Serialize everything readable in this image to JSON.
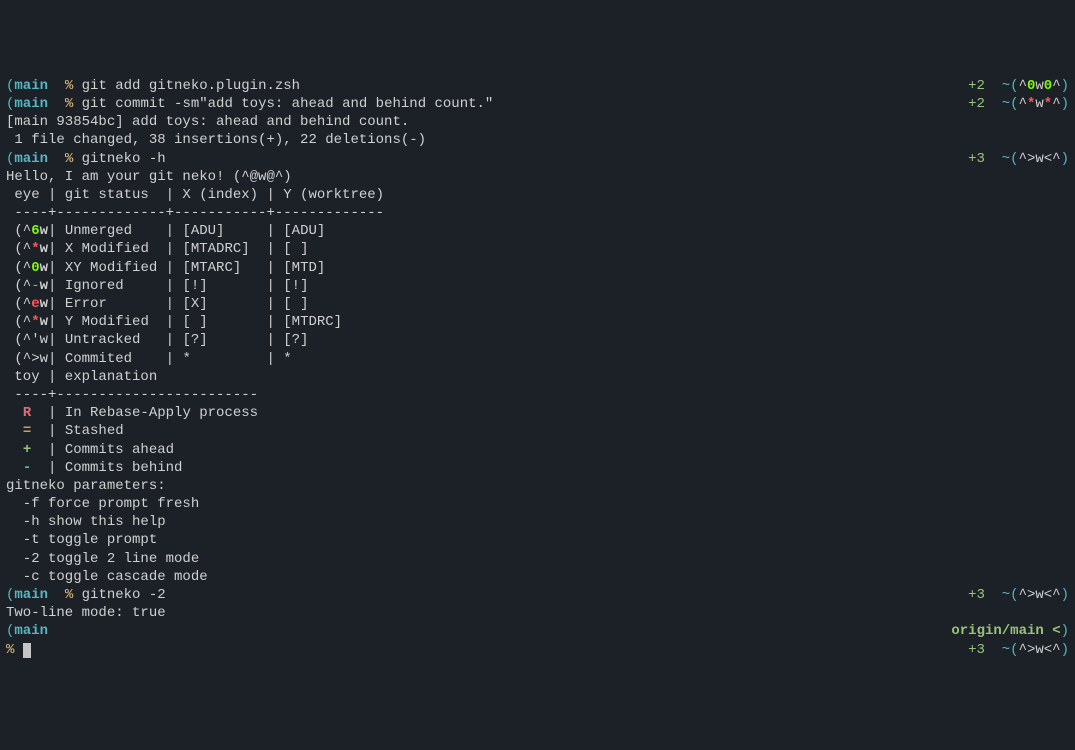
{
  "lines": [
    {
      "left": [
        {
          "text": "(",
          "class": "cyan"
        },
        {
          "text": "main",
          "class": "cyan bold"
        },
        {
          "text": "  ",
          "class": ""
        },
        {
          "text": "%",
          "class": "yellow"
        },
        {
          "text": " git add gitneko.plugin.zsh",
          "class": "white"
        }
      ],
      "right": [
        {
          "text": "+2",
          "class": "green"
        },
        {
          "text": "  ",
          "class": ""
        },
        {
          "text": "~(",
          "class": "cyan"
        },
        {
          "text": "^",
          "class": "white"
        },
        {
          "text": "0",
          "class": "bright-green"
        },
        {
          "text": "w",
          "class": "white"
        },
        {
          "text": "0",
          "class": "bright-green"
        },
        {
          "text": "^",
          "class": "white"
        },
        {
          "text": ")",
          "class": "cyan"
        }
      ]
    },
    {
      "left": [
        {
          "text": "(",
          "class": "cyan"
        },
        {
          "text": "main",
          "class": "cyan bold"
        },
        {
          "text": "  ",
          "class": ""
        },
        {
          "text": "%",
          "class": "yellow"
        },
        {
          "text": " git commit -sm\"add toys: ahead and behind count.\"",
          "class": "white"
        }
      ],
      "right": [
        {
          "text": "+2",
          "class": "green"
        },
        {
          "text": "  ",
          "class": ""
        },
        {
          "text": "~(",
          "class": "cyan"
        },
        {
          "text": "^",
          "class": "white"
        },
        {
          "text": "*",
          "class": "bright-red"
        },
        {
          "text": "w",
          "class": "white"
        },
        {
          "text": "*",
          "class": "bright-red"
        },
        {
          "text": "^",
          "class": "white"
        },
        {
          "text": ")",
          "class": "cyan"
        }
      ]
    },
    {
      "left": [
        {
          "text": "[main 93854bc] add toys: ahead and behind count.",
          "class": "white"
        }
      ],
      "right": []
    },
    {
      "left": [
        {
          "text": " 1 file changed, 38 insertions(+), 22 deletions(-)",
          "class": "white"
        }
      ],
      "right": []
    },
    {
      "left": [
        {
          "text": "(",
          "class": "cyan"
        },
        {
          "text": "main",
          "class": "cyan bold"
        },
        {
          "text": "  ",
          "class": ""
        },
        {
          "text": "%",
          "class": "yellow"
        },
        {
          "text": " gitneko -h",
          "class": "white"
        }
      ],
      "right": [
        {
          "text": "+3",
          "class": "green"
        },
        {
          "text": "  ",
          "class": ""
        },
        {
          "text": "~(",
          "class": "cyan"
        },
        {
          "text": "^>w<^",
          "class": "white"
        },
        {
          "text": ")",
          "class": "cyan"
        }
      ]
    },
    {
      "left": [
        {
          "text": "Hello, I am your git neko! (^@w@^)",
          "class": "white"
        }
      ],
      "right": []
    },
    {
      "left": [
        {
          "text": "",
          "class": ""
        }
      ],
      "right": []
    },
    {
      "left": [
        {
          "text": " eye | git status  | X (index) | Y (worktree)",
          "class": "white"
        }
      ],
      "right": []
    },
    {
      "left": [
        {
          "text": " ----+-------------+-----------+-------------",
          "class": "white"
        }
      ],
      "right": []
    },
    {
      "left": [
        {
          "text": " (^",
          "class": "white"
        },
        {
          "text": "6",
          "class": "bright-green"
        },
        {
          "text": "w",
          "class": "white bold"
        },
        {
          "text": "| Unmerged    | [ADU]     | [ADU]",
          "class": "white"
        }
      ],
      "right": []
    },
    {
      "left": [
        {
          "text": " (^",
          "class": "white"
        },
        {
          "text": "*",
          "class": "bright-red"
        },
        {
          "text": "w",
          "class": "white bold"
        },
        {
          "text": "| X Modified  | [MTADRC]  | [ ]",
          "class": "white"
        }
      ],
      "right": []
    },
    {
      "left": [
        {
          "text": " (^",
          "class": "white"
        },
        {
          "text": "0",
          "class": "bright-green"
        },
        {
          "text": "w",
          "class": "white bold"
        },
        {
          "text": "| XY Modified | [MTARC]   | [MTD]",
          "class": "white"
        }
      ],
      "right": []
    },
    {
      "left": [
        {
          "text": " (^",
          "class": "white"
        },
        {
          "text": "-",
          "class": "cyan"
        },
        {
          "text": "w",
          "class": "white bold"
        },
        {
          "text": "| Ignored     | [!]       | [!]",
          "class": "white"
        }
      ],
      "right": []
    },
    {
      "left": [
        {
          "text": " (^",
          "class": "white"
        },
        {
          "text": "e",
          "class": "bright-red"
        },
        {
          "text": "w",
          "class": "white bold"
        },
        {
          "text": "| Error       | [X]       | [ ]",
          "class": "white"
        }
      ],
      "right": []
    },
    {
      "left": [
        {
          "text": " (^",
          "class": "white"
        },
        {
          "text": "*",
          "class": "bright-red"
        },
        {
          "text": "w",
          "class": "white bold"
        },
        {
          "text": "| Y Modified  | [ ]       | [MTDRC]",
          "class": "white"
        }
      ],
      "right": []
    },
    {
      "left": [
        {
          "text": " (^'w",
          "class": "white"
        },
        {
          "text": "| Untracked   | [?]       | [?]",
          "class": "white"
        }
      ],
      "right": []
    },
    {
      "left": [
        {
          "text": " (^>w",
          "class": "white"
        },
        {
          "text": "| Commited    | *         | *",
          "class": "white"
        }
      ],
      "right": []
    },
    {
      "left": [
        {
          "text": "",
          "class": ""
        }
      ],
      "right": []
    },
    {
      "left": [
        {
          "text": " toy | explanation",
          "class": "white"
        }
      ],
      "right": []
    },
    {
      "left": [
        {
          "text": " ----+------------------------",
          "class": "white"
        }
      ],
      "right": []
    },
    {
      "left": [
        {
          "text": "  ",
          "class": ""
        },
        {
          "text": "R",
          "class": "red bold"
        },
        {
          "text": "  | In Rebase-Apply process",
          "class": "white"
        }
      ],
      "right": []
    },
    {
      "left": [
        {
          "text": "  ",
          "class": ""
        },
        {
          "text": "=",
          "class": "orange bold"
        },
        {
          "text": "  | Stashed",
          "class": "white"
        }
      ],
      "right": []
    },
    {
      "left": [
        {
          "text": "  ",
          "class": ""
        },
        {
          "text": "+",
          "class": "green bold"
        },
        {
          "text": "  | Commits ahead",
          "class": "white"
        }
      ],
      "right": []
    },
    {
      "left": [
        {
          "text": "  ",
          "class": ""
        },
        {
          "text": "-",
          "class": "cyan bold"
        },
        {
          "text": "  | Commits behind",
          "class": "white"
        }
      ],
      "right": []
    },
    {
      "left": [
        {
          "text": "",
          "class": ""
        }
      ],
      "right": []
    },
    {
      "left": [
        {
          "text": "gitneko parameters:",
          "class": "white"
        }
      ],
      "right": []
    },
    {
      "left": [
        {
          "text": "  -f force prompt fresh",
          "class": "white"
        }
      ],
      "right": []
    },
    {
      "left": [
        {
          "text": "  -h show this help",
          "class": "white"
        }
      ],
      "right": []
    },
    {
      "left": [
        {
          "text": "  -t toggle prompt",
          "class": "white"
        }
      ],
      "right": []
    },
    {
      "left": [
        {
          "text": "  -2 toggle 2 line mode",
          "class": "white"
        }
      ],
      "right": []
    },
    {
      "left": [
        {
          "text": "  -c toggle cascade mode",
          "class": "white"
        }
      ],
      "right": []
    },
    {
      "left": [
        {
          "text": "",
          "class": ""
        }
      ],
      "right": []
    },
    {
      "left": [
        {
          "text": "(",
          "class": "cyan"
        },
        {
          "text": "main",
          "class": "cyan bold"
        },
        {
          "text": "  ",
          "class": ""
        },
        {
          "text": "%",
          "class": "yellow"
        },
        {
          "text": " gitneko -2",
          "class": "white"
        }
      ],
      "right": [
        {
          "text": "+3",
          "class": "green"
        },
        {
          "text": "  ",
          "class": ""
        },
        {
          "text": "~(",
          "class": "cyan"
        },
        {
          "text": "^>w<^",
          "class": "white"
        },
        {
          "text": ")",
          "class": "cyan"
        }
      ]
    },
    {
      "left": [
        {
          "text": "Two-line mode: true",
          "class": "white"
        }
      ],
      "right": []
    },
    {
      "left": [
        {
          "text": "(",
          "class": "cyan"
        },
        {
          "text": "main",
          "class": "cyan bold"
        }
      ],
      "right": [
        {
          "text": "origin/main <",
          "class": "green bold"
        },
        {
          "text": ")",
          "class": "cyan"
        }
      ]
    },
    {
      "left": [
        {
          "text": "%",
          "class": "yellow"
        },
        {
          "text": " ",
          "class": ""
        }
      ],
      "right": [
        {
          "text": "+3",
          "class": "green"
        },
        {
          "text": "  ",
          "class": ""
        },
        {
          "text": "~(",
          "class": "cyan"
        },
        {
          "text": "^>w<^",
          "class": "white"
        },
        {
          "text": ")",
          "class": "cyan"
        }
      ],
      "cursor": true
    }
  ]
}
